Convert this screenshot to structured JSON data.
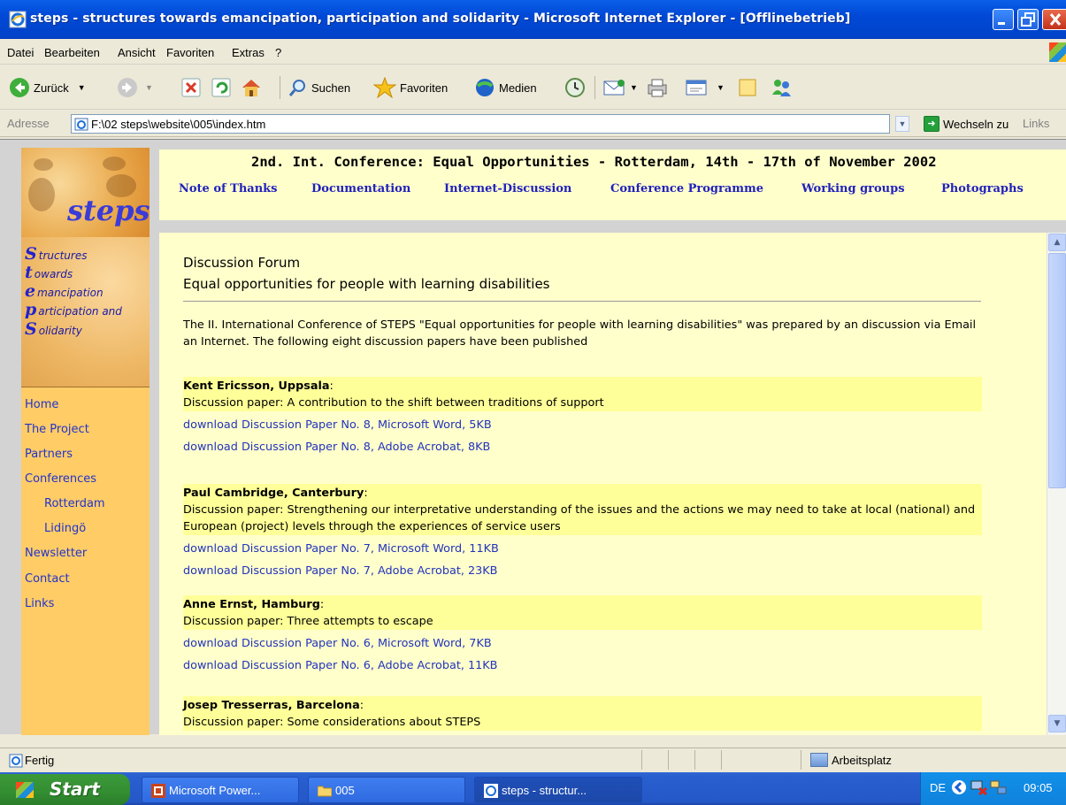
{
  "window": {
    "title": "steps - structures towards emancipation, participation and solidarity - Microsoft Internet Explorer - [Offlinebetrieb]"
  },
  "menu": [
    "Datei",
    "Bearbeiten",
    "Ansicht",
    "Favoriten",
    "Extras",
    "?"
  ],
  "toolbar": {
    "back": "Zurück",
    "search": "Suchen",
    "favorites": "Favoriten",
    "media": "Medien"
  },
  "address": {
    "label": "Adresse",
    "value": "F:\\02 steps\\website\\005\\index.htm",
    "go": "Wechseln zu",
    "links": "Links"
  },
  "logo": {
    "word": "steps",
    "acronym": [
      {
        "letter": "S",
        "rest": "tructures"
      },
      {
        "letter": "t",
        "rest": "owards"
      },
      {
        "letter": "e",
        "rest": "mancipation"
      },
      {
        "letter": "p",
        "rest": "articipation and"
      },
      {
        "letter": "S",
        "rest": "olidarity"
      }
    ]
  },
  "sidebar": {
    "items": [
      "Home",
      "The Project",
      "Partners",
      "Conferences",
      "Rotterdam",
      "Lidingö",
      "Newsletter",
      "Contact",
      "Links"
    ]
  },
  "header": {
    "title": "2nd. Int. Conference: Equal Opportunities - Rotterdam, 14th - 17th of November 2002",
    "links": [
      "Note of Thanks",
      "Documentation",
      "Internet-Discussion",
      "Conference Programme",
      "Working groups",
      "Photographs"
    ]
  },
  "main": {
    "heading": "Discussion Forum",
    "subheading": "Equal opportunities for people with learning disabilities",
    "intro": "The II. International Conference of STEPS \"Equal opportunities for people with learning disabilities\" was prepared by an discussion via Email an Internet. The following eight discussion papers have been published",
    "entries": [
      {
        "author": "Kent Ericsson, Uppsala",
        "paper": "Discussion paper: A contribution to the shift between traditions of support",
        "word": "download Discussion Paper No. 8, Microsoft Word, 5KB",
        "pdf": "download Discussion Paper No. 8, Adobe Acrobat, 8KB"
      },
      {
        "author": "Paul Cambridge, Canterbury",
        "paper": "Discussion paper: Strengthening our interpretative understanding of the issues and the actions we may need to take at local (national) and European (project) levels through the experiences of service users",
        "word": "download Discussion Paper No. 7, Microsoft Word, 11KB",
        "pdf": "download Discussion Paper No. 7, Adobe Acrobat, 23KB"
      },
      {
        "author": "Anne Ernst, Hamburg",
        "paper": "Discussion paper: Three attempts to escape",
        "word": "download Discussion Paper No. 6, Microsoft Word, 7KB",
        "pdf": "download Discussion Paper No. 6, Adobe Acrobat, 11KB"
      },
      {
        "author": "Josep Tresserras, Barcelona",
        "paper": "Discussion paper: Some considerations about STEPS"
      }
    ]
  },
  "status": {
    "text": "Fertig",
    "zone": "Arbeitsplatz"
  },
  "taskbar": {
    "start": "Start",
    "tasks": [
      "Microsoft Power...",
      "005",
      "steps - structur..."
    ],
    "lang": "DE",
    "clock": "09:05"
  }
}
